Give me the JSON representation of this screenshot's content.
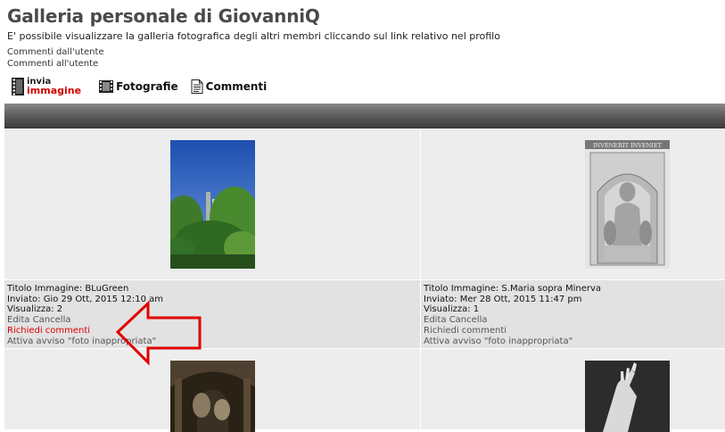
{
  "page": {
    "title": "Galleria personale di GiovanniQ",
    "subtitle": "E' possibile visualizzare la galleria fotografica degli altri membri cliccando sul link relativo nel profilo"
  },
  "user_links": [
    "Commenti dall'utente",
    "Commenti all'utente"
  ],
  "nav": {
    "invia_top": "invia",
    "invia_bottom": "immagine",
    "fotografie": "Fotografie",
    "commenti": "Commenti"
  },
  "photos": [
    {
      "title": "Titolo Immagine: BLuGreen",
      "sent": "Inviato: Gio 29 Ott, 2015 12:10 am",
      "views": "Visualizza: 2",
      "edit": "Edita",
      "delete": "Cancella",
      "request": "Richiedi commenti",
      "report": "Attiva avviso \"foto inappropriata\""
    },
    {
      "title": "Titolo Immagine: S.Maria sopra Minerva",
      "sent": "Inviato: Mer 28 Ott, 2015 11:47 pm",
      "views": "Visualizza: 1",
      "edit": "Edita",
      "delete": "Cancella",
      "request": "Richiedi commenti",
      "report": "Attiva avviso \"foto inappropriata\""
    }
  ],
  "relief_inscription": "INVENERIT  INVENIET",
  "colors": {
    "highlight_red": "#e00000",
    "header_bar": "#5e5e5e",
    "cell_bg": "#ededed"
  }
}
